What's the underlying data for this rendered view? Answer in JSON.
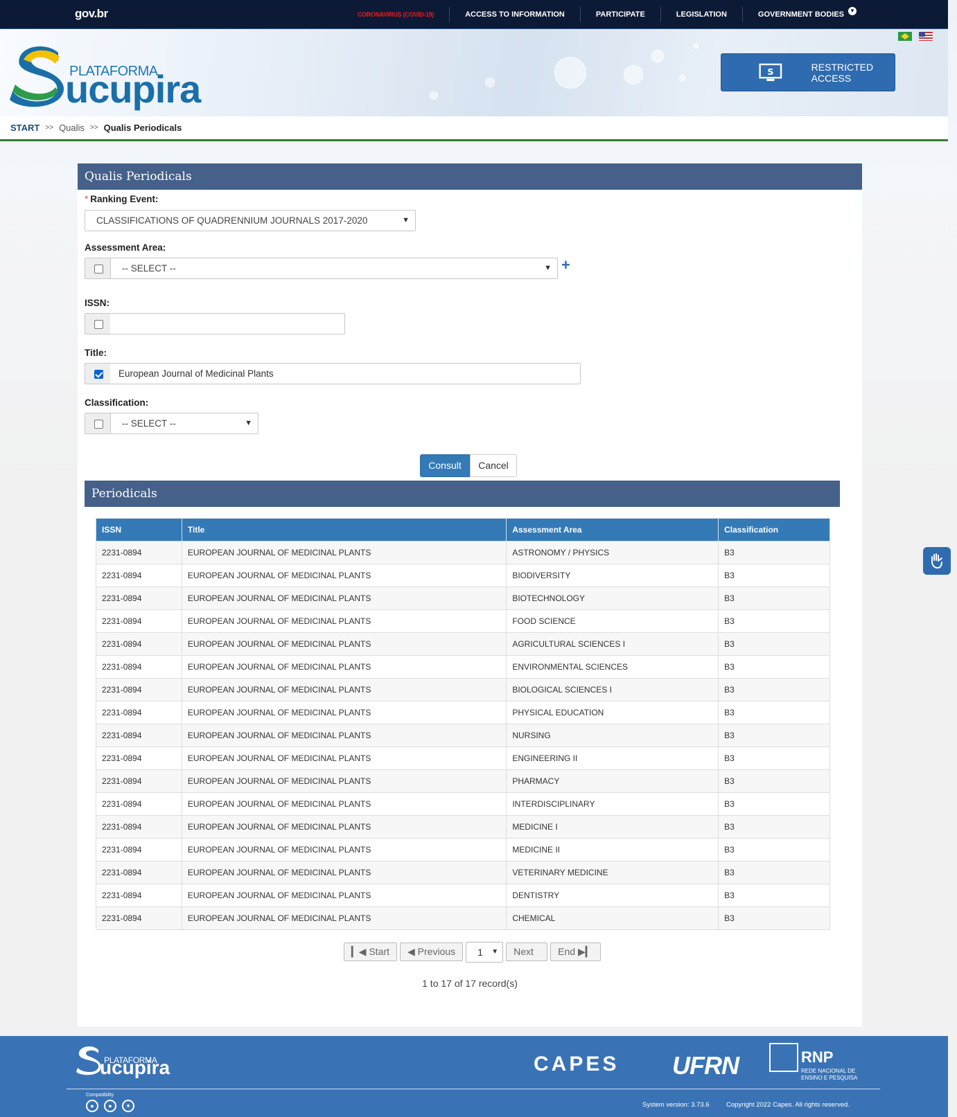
{
  "topbar": {
    "brand": "gov.br",
    "nav": [
      "CORONAVIRUS (COVID-19)",
      "ACCESS TO INFORMATION",
      "PARTICIPATE",
      "LEGISLATION",
      "GOVERNMENT BODIES"
    ]
  },
  "header": {
    "logo_prefix": "PLATAFORMA",
    "logo_name": "ucupira",
    "restricted_label": "RESTRICTED ACCESS"
  },
  "breadcrumb": [
    "START",
    "Qualis",
    "Qualis Periodicals"
  ],
  "breadcrumb_sep": ">>",
  "form": {
    "title": "Qualis Periodicals",
    "required_mark": "*",
    "ranking_label": "Ranking Event:",
    "ranking_value": "CLASSIFICATIONS OF QUADRENNIUM JOURNALS 2017-2020",
    "area_label": "Assessment Area:",
    "area_value": "-- SELECT --",
    "issn_label": "ISSN:",
    "issn_value": "",
    "title_label": "Title:",
    "title_value": "European Journal of Medicinal Plants",
    "class_label": "Classification:",
    "class_value": "-- SELECT --",
    "consult": "Consult",
    "cancel": "Cancel"
  },
  "results": {
    "title": "Periodicals",
    "columns": [
      "ISSN",
      "Title",
      "Assessment Area",
      "Classification"
    ],
    "rows": [
      [
        "2231-0894",
        "EUROPEAN JOURNAL OF MEDICINAL PLANTS",
        "ASTRONOMY / PHYSICS",
        "B3"
      ],
      [
        "2231-0894",
        "EUROPEAN JOURNAL OF MEDICINAL PLANTS",
        "BIODIVERSITY",
        "B3"
      ],
      [
        "2231-0894",
        "EUROPEAN JOURNAL OF MEDICINAL PLANTS",
        "BIOTECHNOLOGY",
        "B3"
      ],
      [
        "2231-0894",
        "EUROPEAN JOURNAL OF MEDICINAL PLANTS",
        "FOOD SCIENCE",
        "B3"
      ],
      [
        "2231-0894",
        "EUROPEAN JOURNAL OF MEDICINAL PLANTS",
        "AGRICULTURAL SCIENCES I",
        "B3"
      ],
      [
        "2231-0894",
        "EUROPEAN JOURNAL OF MEDICINAL PLANTS",
        "ENVIRONMENTAL SCIENCES",
        "B3"
      ],
      [
        "2231-0894",
        "EUROPEAN JOURNAL OF MEDICINAL PLANTS",
        "BIOLOGICAL SCIENCES I",
        "B3"
      ],
      [
        "2231-0894",
        "EUROPEAN JOURNAL OF MEDICINAL PLANTS",
        "PHYSICAL EDUCATION",
        "B3"
      ],
      [
        "2231-0894",
        "EUROPEAN JOURNAL OF MEDICINAL PLANTS",
        "NURSING",
        "B3"
      ],
      [
        "2231-0894",
        "EUROPEAN JOURNAL OF MEDICINAL PLANTS",
        "ENGINEERING II",
        "B3"
      ],
      [
        "2231-0894",
        "EUROPEAN JOURNAL OF MEDICINAL PLANTS",
        "PHARMACY",
        "B3"
      ],
      [
        "2231-0894",
        "EUROPEAN JOURNAL OF MEDICINAL PLANTS",
        "INTERDISCIPLINARY",
        "B3"
      ],
      [
        "2231-0894",
        "EUROPEAN JOURNAL OF MEDICINAL PLANTS",
        "MEDICINE I",
        "B3"
      ],
      [
        "2231-0894",
        "EUROPEAN JOURNAL OF MEDICINAL PLANTS",
        "MEDICINE II",
        "B3"
      ],
      [
        "2231-0894",
        "EUROPEAN JOURNAL OF MEDICINAL PLANTS",
        "VETERINARY MEDICINE",
        "B3"
      ],
      [
        "2231-0894",
        "EUROPEAN JOURNAL OF MEDICINAL PLANTS",
        "DENTISTRY",
        "B3"
      ],
      [
        "2231-0894",
        "EUROPEAN JOURNAL OF MEDICINAL PLANTS",
        "CHEMICAL",
        "B3"
      ]
    ],
    "pager": {
      "start": "Start",
      "previous": "Previous",
      "page": "1",
      "next": "Next",
      "end": "End"
    },
    "records_info": "1 to 17 of 17 record(s)"
  },
  "footer": {
    "logo_prefix": "PLATAFORMA",
    "logo_name": "ucupira",
    "partners": [
      "CAPES",
      "UFRN",
      "RNP"
    ],
    "rnp_sub": "REDE NACIONAL DE ENSINO E PESQUISA",
    "compat_label": "Compatibility",
    "version": "System version: 3.73.6",
    "copyright": "Copyright 2022 Capes. All rights reserved."
  },
  "icons": [
    "chevron-down-icon",
    "plus-icon",
    "monitor-icon",
    "accessibility-hand-icon",
    "chrome-icon",
    "firefox-icon",
    "safari-icon",
    "first-page-icon",
    "previous-page-icon",
    "last-page-icon"
  ],
  "colors": {
    "topbar": "#0c1a36",
    "covid": "#e51b23",
    "panel_header": "#456189",
    "table_header": "#337ab7",
    "footer": "#3a73b5",
    "breadcrumb_border": "#2e7d32"
  }
}
